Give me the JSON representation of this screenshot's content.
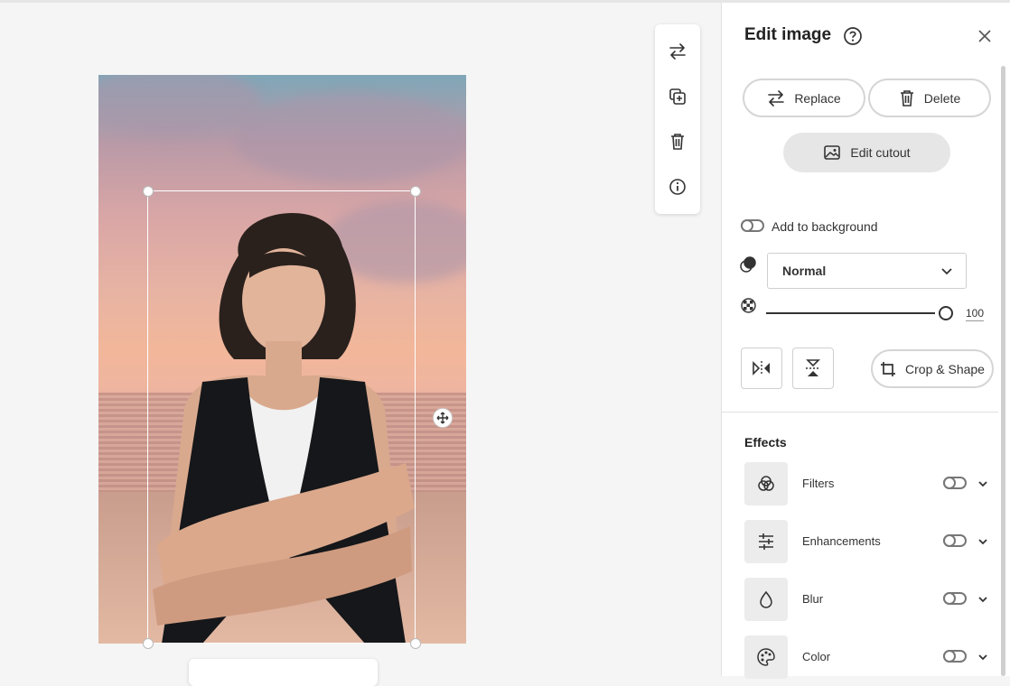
{
  "toolbar": {
    "items": [
      {
        "name": "replace",
        "icon": "swap-arrows-icon"
      },
      {
        "name": "duplicate",
        "icon": "duplicate-plus-icon"
      },
      {
        "name": "delete",
        "icon": "trash-icon"
      },
      {
        "name": "info",
        "icon": "info-icon"
      }
    ]
  },
  "panel": {
    "title": "Edit image",
    "replace_label": "Replace",
    "delete_label": "Delete",
    "edit_cutout_label": "Edit cutout",
    "add_to_background_label": "Add to background",
    "add_to_background_on": false,
    "blend_mode": "Normal",
    "opacity_value": "100",
    "crop_shape_label": "Crop & Shape",
    "effects_title": "Effects",
    "effects": [
      {
        "label": "Filters",
        "icon": "filters-icon",
        "on": false
      },
      {
        "label": "Enhancements",
        "icon": "sliders-icon",
        "on": false
      },
      {
        "label": "Blur",
        "icon": "droplet-icon",
        "on": false
      },
      {
        "label": "Color",
        "icon": "palette-icon",
        "on": false
      }
    ]
  },
  "colors": {
    "accent": "#222222",
    "panel_bg": "#ffffff",
    "canvas_bg": "#f5f5f5"
  }
}
